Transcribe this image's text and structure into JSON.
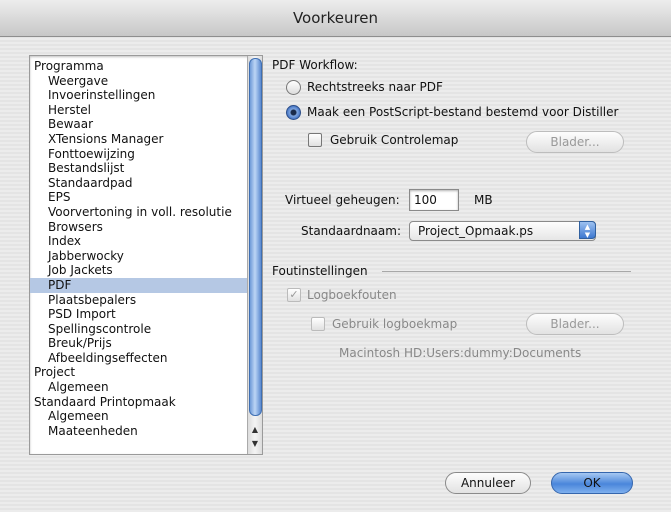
{
  "window": {
    "title": "Voorkeuren"
  },
  "sidebar": {
    "items": [
      {
        "label": "Programma",
        "level": 0
      },
      {
        "label": "Weergave",
        "level": 1
      },
      {
        "label": "Invoerinstellingen",
        "level": 1
      },
      {
        "label": "Herstel",
        "level": 1
      },
      {
        "label": "Bewaar",
        "level": 1
      },
      {
        "label": "XTensions Manager",
        "level": 1
      },
      {
        "label": "Fonttoewijzing",
        "level": 1
      },
      {
        "label": "Bestandslijst",
        "level": 1
      },
      {
        "label": "Standaardpad",
        "level": 1
      },
      {
        "label": "EPS",
        "level": 1
      },
      {
        "label": "Voorvertoning in voll. resolutie",
        "level": 1
      },
      {
        "label": "Browsers",
        "level": 1
      },
      {
        "label": "Index",
        "level": 1
      },
      {
        "label": "Jabberwocky",
        "level": 1
      },
      {
        "label": "Job Jackets",
        "level": 1
      },
      {
        "label": "PDF",
        "level": 1,
        "selected": true
      },
      {
        "label": "Plaatsbepalers",
        "level": 1
      },
      {
        "label": "PSD Import",
        "level": 1
      },
      {
        "label": "Spellingscontrole",
        "level": 1
      },
      {
        "label": "Breuk/Prijs",
        "level": 1
      },
      {
        "label": "Afbeeldingseffecten",
        "level": 1
      },
      {
        "label": "Project",
        "level": 0
      },
      {
        "label": "Algemeen",
        "level": 1
      },
      {
        "label": "Standaard Printopmaak",
        "level": 0
      },
      {
        "label": "Algemeen",
        "level": 1
      },
      {
        "label": "Maateenheden",
        "level": 1
      }
    ]
  },
  "pdf_workflow": {
    "heading": "PDF Workflow:",
    "option_direct": "Rechtstreeks naar PDF",
    "option_postscript": "Maak een PostScript-bestand bestemd voor Distiller",
    "selected": "option_postscript",
    "use_folder_label": "Gebruik Controlemap",
    "use_folder_checked": false,
    "browse_label": "Blader..."
  },
  "memory": {
    "label": "Virtueel geheugen:",
    "value": "100",
    "unit": "MB"
  },
  "default_name": {
    "label": "Standaardnaam:",
    "value": "Project_Opmaak.ps"
  },
  "errors": {
    "heading": "Foutinstellingen",
    "log_errors_label": "Logboekfouten",
    "log_errors_checked": true,
    "use_log_folder_label": "Gebruik logboekmap",
    "use_log_folder_checked": false,
    "browse_label": "Blader...",
    "path": "Macintosh HD:Users:dummy:Documents"
  },
  "footer": {
    "cancel_label": "Annuleer",
    "ok_label": "OK"
  }
}
